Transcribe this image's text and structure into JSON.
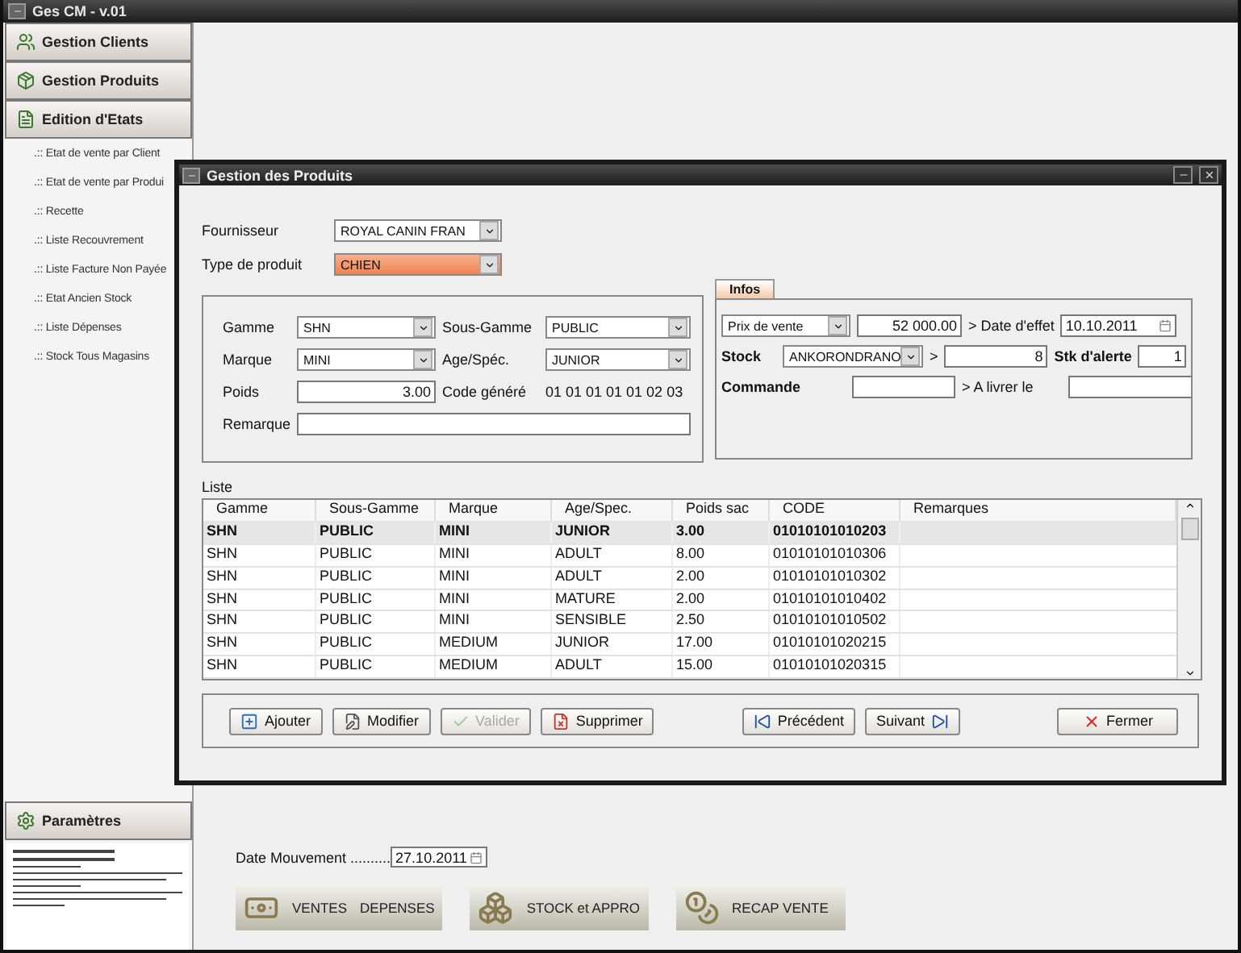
{
  "window": {
    "title": "Ges CM - v.01"
  },
  "sidebar": {
    "sections": [
      {
        "label": "Gestion Clients",
        "kind": "clients"
      },
      {
        "label": "Gestion Produits",
        "kind": "products"
      },
      {
        "label": "Edition d'Etats",
        "kind": "reports"
      }
    ],
    "report_links": [
      ".:: Etat de vente par Client",
      ".:: Etat de vente par Produi",
      ".:: Recette",
      ".:: Liste Recouvrement",
      ".:: Liste Facture Non Payée",
      ".:: Etat Ancien Stock",
      ".:: Liste Dépenses",
      ".:: Stock Tous Magasins"
    ],
    "settings_button": "Paramètres"
  },
  "date_mouvement": {
    "label": "Date Mouvement ..........",
    "value": "27.10.2011"
  },
  "shortcuts": [
    {
      "kind": "money",
      "labels": [
        "VENTES",
        "DEPENSES"
      ]
    },
    {
      "kind": "boxes",
      "labels": [
        "STOCK et APPRO"
      ]
    },
    {
      "kind": "coins",
      "labels": [
        "RECAP VENTE"
      ]
    }
  ],
  "dialog": {
    "title": "Gestion des Produits",
    "supplier": {
      "label": "Fournisseur",
      "value": "ROYAL CANIN FRAN",
      "focused": false
    },
    "product_type": {
      "label": "Type de produit",
      "value": "CHIEN",
      "focused": true
    },
    "fields": [
      {
        "label": "Gamme",
        "kind": "combo",
        "value": "SHN"
      },
      {
        "label": "Sous-Gamme",
        "kind": "combo",
        "value": "PUBLIC"
      },
      {
        "label": "Marque",
        "kind": "combo",
        "value": "MINI"
      },
      {
        "label": "Age/Spéc.",
        "kind": "combo",
        "value": "JUNIOR"
      },
      {
        "label": "Poids",
        "kind": "number",
        "value": "3.00"
      },
      {
        "label": "Code généré",
        "kind": "text",
        "value": "01 01 01 01 01 02 03"
      },
      {
        "label": "Remarque",
        "kind": "wide"
      }
    ],
    "infos": {
      "tab": {
        "label": "Infos",
        "selected": true
      },
      "price_type": "Prix de vente",
      "price": "52 000.00",
      "date_label": "> Date d'effet",
      "date": "10.10.2011",
      "stock_label": "Stock",
      "stock_place": "ANKORONDRANO",
      "stock_arrow": ">",
      "stock_qty": "8",
      "alert_label": "Stk d'alerte",
      "alert_qty": "1",
      "order_label": "Commande",
      "deliver_label": "> A livrer le"
    },
    "list_label": "Liste",
    "table": {
      "columns": [
        "Gamme",
        "Sous-Gamme",
        "Marque",
        "Age/Spec.",
        "Poids sac",
        "CODE",
        "Remarques"
      ],
      "rows": [
        {
          "selected": true,
          "cells": [
            "SHN",
            "PUBLIC",
            "MINI",
            "JUNIOR",
            "3.00",
            "01010101010203"
          ]
        },
        {
          "selected": false,
          "cells": [
            "SHN",
            "PUBLIC",
            "MINI",
            "ADULT",
            "8.00",
            "01010101010306"
          ]
        },
        {
          "selected": false,
          "cells": [
            "SHN",
            "PUBLIC",
            "MINI",
            "ADULT",
            "2.00",
            "01010101010302"
          ]
        },
        {
          "selected": false,
          "cells": [
            "SHN",
            "PUBLIC",
            "MINI",
            "MATURE",
            "2.00",
            "01010101010402"
          ]
        },
        {
          "selected": false,
          "cells": [
            "SHN",
            "PUBLIC",
            "MINI",
            "SENSIBLE",
            "2.50",
            "01010101010502"
          ]
        },
        {
          "selected": false,
          "cells": [
            "SHN",
            "PUBLIC",
            "MEDIUM",
            "JUNIOR",
            "17.00",
            "01010101020215"
          ]
        },
        {
          "selected": false,
          "cells": [
            "SHN",
            "PUBLIC",
            "MEDIUM",
            "ADULT",
            "15.00",
            "01010101020315"
          ]
        }
      ]
    },
    "buttons": [
      {
        "label": "Ajouter",
        "kind": "add",
        "disabled": false
      },
      {
        "label": "Modifier",
        "kind": "edit",
        "disabled": false
      },
      {
        "label": "Valider",
        "kind": "check",
        "disabled": true
      },
      {
        "label": "Supprimer",
        "kind": "delete",
        "disabled": false
      },
      {
        "label": "Précédent",
        "kind": "prev",
        "disabled": false
      },
      {
        "label": "Suivant",
        "kind": "next",
        "disabled": false
      },
      {
        "label": "Fermer",
        "kind": "close",
        "disabled": false
      }
    ]
  }
}
